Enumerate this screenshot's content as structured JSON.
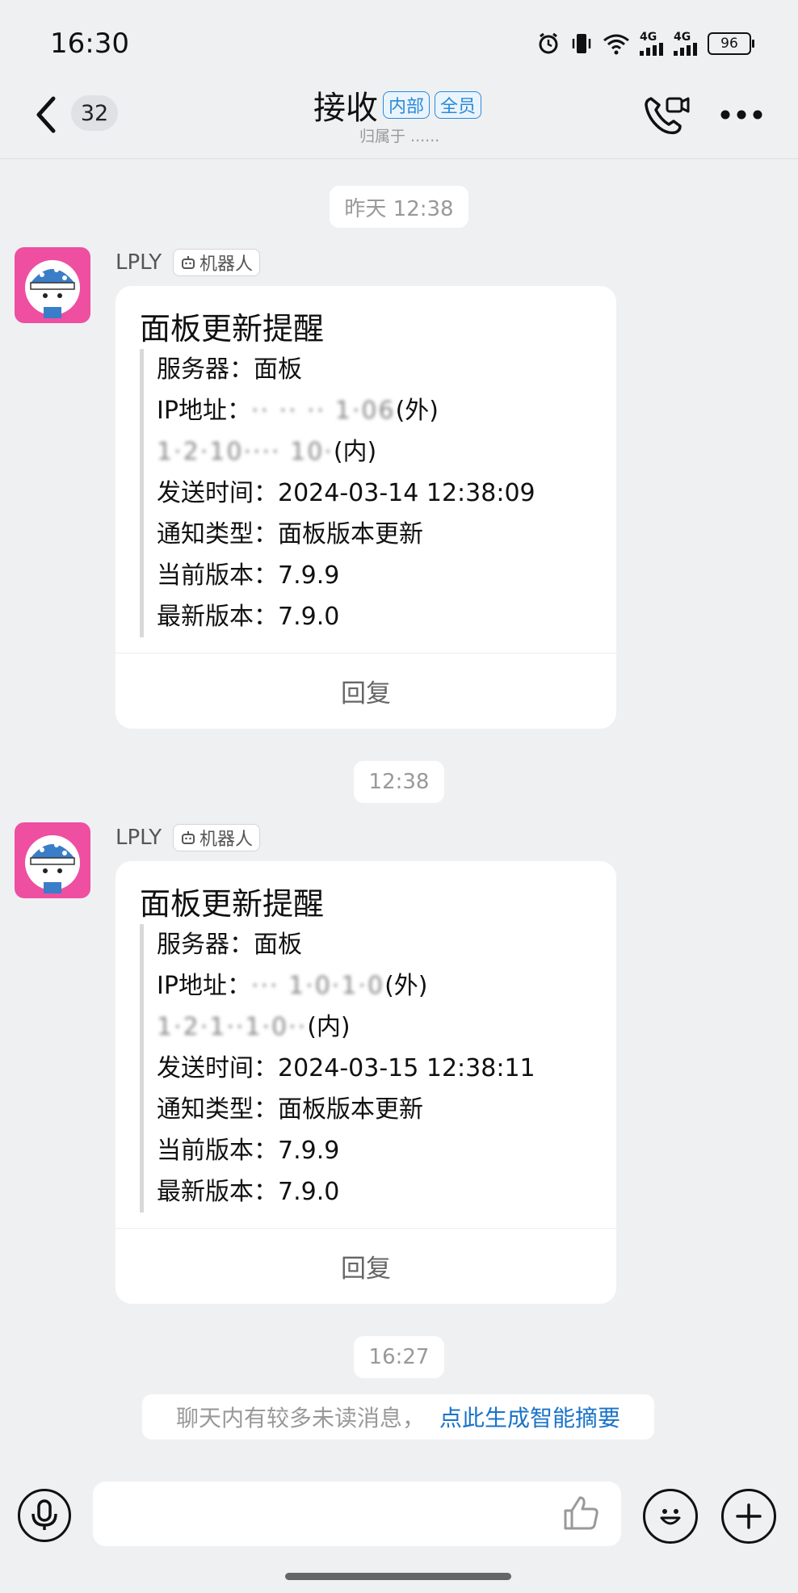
{
  "status_bar": {
    "time": "16:30",
    "signal_1": "4G",
    "signal_2": "4G",
    "battery": "96",
    "icons": [
      "alarm-icon",
      "vibrate-icon",
      "wifi-icon",
      "signal-icon",
      "signal-icon",
      "battery-icon"
    ]
  },
  "header": {
    "unread_count": "32",
    "title": "接收",
    "tags": [
      "内部",
      "全员"
    ],
    "subtitle": "归属于 ......"
  },
  "messages": [
    {
      "time_chip": "昨天 12:38",
      "sender": "LPLY",
      "sender_tag": "机器人",
      "card_title": "面板更新提醒",
      "rows": [
        {
          "label": "服务器：",
          "value": "面板"
        },
        {
          "label": "IP地址：",
          "value": "(外)",
          "masked": "·· ·· ·· 1·06"
        },
        {
          "label": "",
          "value": "(内)",
          "masked": "1·2·10···· 10·"
        },
        {
          "label": "发送时间：",
          "value": "2024-03-14 12:38:09"
        },
        {
          "label": "通知类型：",
          "value": "面板版本更新"
        },
        {
          "label": "当前版本：",
          "value": "7.9.9"
        },
        {
          "label": "最新版本：",
          "value": "7.9.0"
        }
      ],
      "reply_label": "回复"
    },
    {
      "time_chip": "12:38",
      "sender": "LPLY",
      "sender_tag": "机器人",
      "card_title": "面板更新提醒",
      "rows": [
        {
          "label": "服务器：",
          "value": "面板"
        },
        {
          "label": "IP地址：",
          "value": "(外)",
          "masked": "··· 1·0·1·0"
        },
        {
          "label": "",
          "value": "(内)",
          "masked": "1·2·1··1·0··"
        },
        {
          "label": "发送时间：",
          "value": "2024-03-15 12:38:11"
        },
        {
          "label": "通知类型：",
          "value": "面板版本更新"
        },
        {
          "label": "当前版本：",
          "value": "7.9.9"
        },
        {
          "label": "最新版本：",
          "value": "7.9.0"
        }
      ],
      "reply_label": "回复"
    }
  ],
  "time_chip_3": "16:27",
  "summary": {
    "text": "聊天内有较多未读消息，",
    "link": "点此生成智能摘要"
  },
  "input_bar": {
    "icons": [
      "microphone-icon",
      "thumbs-up-icon",
      "emoji-icon",
      "plus-icon"
    ]
  }
}
